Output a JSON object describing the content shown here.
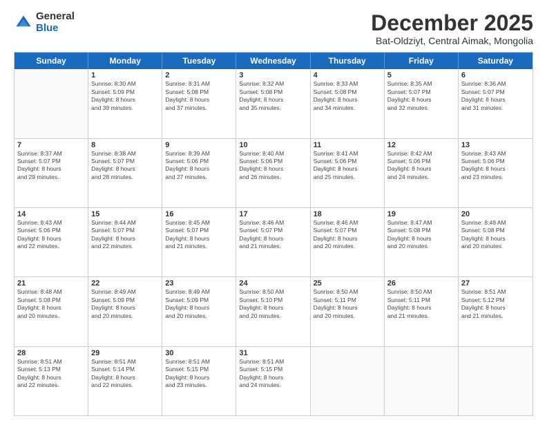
{
  "logo": {
    "general": "General",
    "blue": "Blue"
  },
  "title": "December 2025",
  "subtitle": "Bat-Oldziyt, Central Aimak, Mongolia",
  "header_days": [
    "Sunday",
    "Monday",
    "Tuesday",
    "Wednesday",
    "Thursday",
    "Friday",
    "Saturday"
  ],
  "weeks": [
    [
      {
        "day": "",
        "info": ""
      },
      {
        "day": "1",
        "info": "Sunrise: 8:30 AM\nSunset: 5:09 PM\nDaylight: 8 hours\nand 39 minutes."
      },
      {
        "day": "2",
        "info": "Sunrise: 8:31 AM\nSunset: 5:08 PM\nDaylight: 8 hours\nand 37 minutes."
      },
      {
        "day": "3",
        "info": "Sunrise: 8:32 AM\nSunset: 5:08 PM\nDaylight: 8 hours\nand 35 minutes."
      },
      {
        "day": "4",
        "info": "Sunrise: 8:33 AM\nSunset: 5:08 PM\nDaylight: 8 hours\nand 34 minutes."
      },
      {
        "day": "5",
        "info": "Sunrise: 8:35 AM\nSunset: 5:07 PM\nDaylight: 8 hours\nand 32 minutes."
      },
      {
        "day": "6",
        "info": "Sunrise: 8:36 AM\nSunset: 5:07 PM\nDaylight: 8 hours\nand 31 minutes."
      }
    ],
    [
      {
        "day": "7",
        "info": "Sunrise: 8:37 AM\nSunset: 5:07 PM\nDaylight: 8 hours\nand 29 minutes."
      },
      {
        "day": "8",
        "info": "Sunrise: 8:38 AM\nSunset: 5:07 PM\nDaylight: 8 hours\nand 28 minutes."
      },
      {
        "day": "9",
        "info": "Sunrise: 8:39 AM\nSunset: 5:06 PM\nDaylight: 8 hours\nand 27 minutes."
      },
      {
        "day": "10",
        "info": "Sunrise: 8:40 AM\nSunset: 5:06 PM\nDaylight: 8 hours\nand 26 minutes."
      },
      {
        "day": "11",
        "info": "Sunrise: 8:41 AM\nSunset: 5:06 PM\nDaylight: 8 hours\nand 25 minutes."
      },
      {
        "day": "12",
        "info": "Sunrise: 8:42 AM\nSunset: 5:06 PM\nDaylight: 8 hours\nand 24 minutes."
      },
      {
        "day": "13",
        "info": "Sunrise: 8:43 AM\nSunset: 5:06 PM\nDaylight: 8 hours\nand 23 minutes."
      }
    ],
    [
      {
        "day": "14",
        "info": "Sunrise: 8:43 AM\nSunset: 5:06 PM\nDaylight: 8 hours\nand 22 minutes."
      },
      {
        "day": "15",
        "info": "Sunrise: 8:44 AM\nSunset: 5:07 PM\nDaylight: 8 hours\nand 22 minutes."
      },
      {
        "day": "16",
        "info": "Sunrise: 8:45 AM\nSunset: 5:07 PM\nDaylight: 8 hours\nand 21 minutes."
      },
      {
        "day": "17",
        "info": "Sunrise: 8:46 AM\nSunset: 5:07 PM\nDaylight: 8 hours\nand 21 minutes."
      },
      {
        "day": "18",
        "info": "Sunrise: 8:46 AM\nSunset: 5:07 PM\nDaylight: 8 hours\nand 20 minutes."
      },
      {
        "day": "19",
        "info": "Sunrise: 8:47 AM\nSunset: 5:08 PM\nDaylight: 8 hours\nand 20 minutes."
      },
      {
        "day": "20",
        "info": "Sunrise: 8:48 AM\nSunset: 5:08 PM\nDaylight: 8 hours\nand 20 minutes."
      }
    ],
    [
      {
        "day": "21",
        "info": "Sunrise: 8:48 AM\nSunset: 5:08 PM\nDaylight: 8 hours\nand 20 minutes."
      },
      {
        "day": "22",
        "info": "Sunrise: 8:49 AM\nSunset: 5:09 PM\nDaylight: 8 hours\nand 20 minutes."
      },
      {
        "day": "23",
        "info": "Sunrise: 8:49 AM\nSunset: 5:09 PM\nDaylight: 8 hours\nand 20 minutes."
      },
      {
        "day": "24",
        "info": "Sunrise: 8:50 AM\nSunset: 5:10 PM\nDaylight: 8 hours\nand 20 minutes."
      },
      {
        "day": "25",
        "info": "Sunrise: 8:50 AM\nSunset: 5:11 PM\nDaylight: 8 hours\nand 20 minutes."
      },
      {
        "day": "26",
        "info": "Sunrise: 8:50 AM\nSunset: 5:11 PM\nDaylight: 8 hours\nand 21 minutes."
      },
      {
        "day": "27",
        "info": "Sunrise: 8:51 AM\nSunset: 5:12 PM\nDaylight: 8 hours\nand 21 minutes."
      }
    ],
    [
      {
        "day": "28",
        "info": "Sunrise: 8:51 AM\nSunset: 5:13 PM\nDaylight: 8 hours\nand 22 minutes."
      },
      {
        "day": "29",
        "info": "Sunrise: 8:51 AM\nSunset: 5:14 PM\nDaylight: 8 hours\nand 22 minutes."
      },
      {
        "day": "30",
        "info": "Sunrise: 8:51 AM\nSunset: 5:15 PM\nDaylight: 8 hours\nand 23 minutes."
      },
      {
        "day": "31",
        "info": "Sunrise: 8:51 AM\nSunset: 5:15 PM\nDaylight: 8 hours\nand 24 minutes."
      },
      {
        "day": "",
        "info": ""
      },
      {
        "day": "",
        "info": ""
      },
      {
        "day": "",
        "info": ""
      }
    ]
  ]
}
